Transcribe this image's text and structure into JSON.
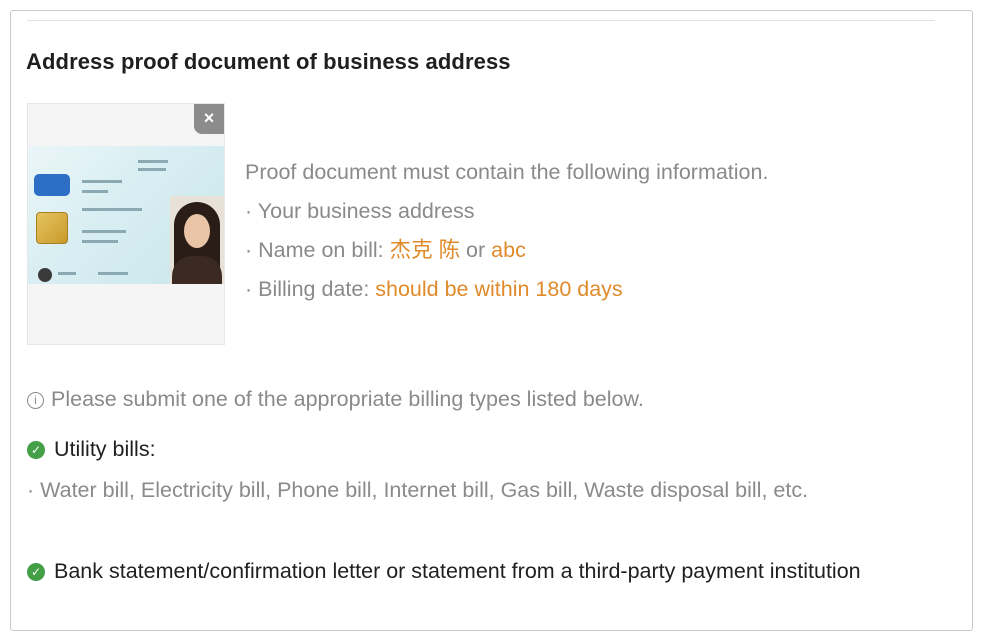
{
  "title": "Address proof document of business address",
  "thumbnail": {
    "close_glyph": "×",
    "icon": "close-icon"
  },
  "requirements": {
    "intro": "Proof document must contain the following information.",
    "address_line": "· Your business address",
    "name_prefix": "· Name on bill: ",
    "name_value_1": "杰克 陈",
    "name_or": " or ",
    "name_value_2": "abc",
    "date_prefix": "· Billing date: ",
    "date_value": "should be within 180 days"
  },
  "notice": {
    "icon": "info-icon",
    "icon_glyph": "i",
    "text": "Please submit one of the appropriate billing types listed below."
  },
  "billing_types": {
    "utility_label": "Utility bills:",
    "utility_list": "· Water bill, Electricity bill, Phone bill, Internet bill, Gas bill, Waste disposal bill, etc.",
    "bank_label": "Bank statement/confirmation letter or statement from a third-party payment institution"
  },
  "colors": {
    "accent_orange": "#e08a2a",
    "check_green": "#43a047",
    "muted_text": "#8a8a8a",
    "heading_text": "#1f1f1f"
  }
}
